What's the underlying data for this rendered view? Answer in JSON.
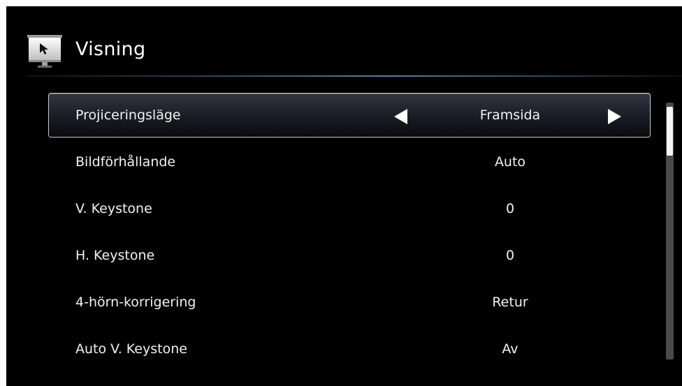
{
  "header": {
    "title": "Visning",
    "icon": "projector-screen-icon"
  },
  "menu": {
    "items": [
      {
        "label": "Projiceringsläge",
        "value": "Framsida",
        "selected": true
      },
      {
        "label": "Bildförhållande",
        "value": "Auto"
      },
      {
        "label": "V. Keystone",
        "value": "0"
      },
      {
        "label": "H. Keystone",
        "value": "0"
      },
      {
        "label": "4-hörn-korrigering",
        "value": "Retur"
      },
      {
        "label": "Auto V. Keystone",
        "value": "Av"
      }
    ],
    "left_arrow_icon": "triangle-left-icon",
    "right_arrow_icon": "triangle-right-icon"
  },
  "scrollbar": {
    "position_fraction": 0.0,
    "visible_fraction": 0.19
  },
  "colors": {
    "background": "#000000",
    "text": "#f2f2f2",
    "accent_line": "#5d7fa5",
    "selected_border": "#c8c8c8"
  }
}
